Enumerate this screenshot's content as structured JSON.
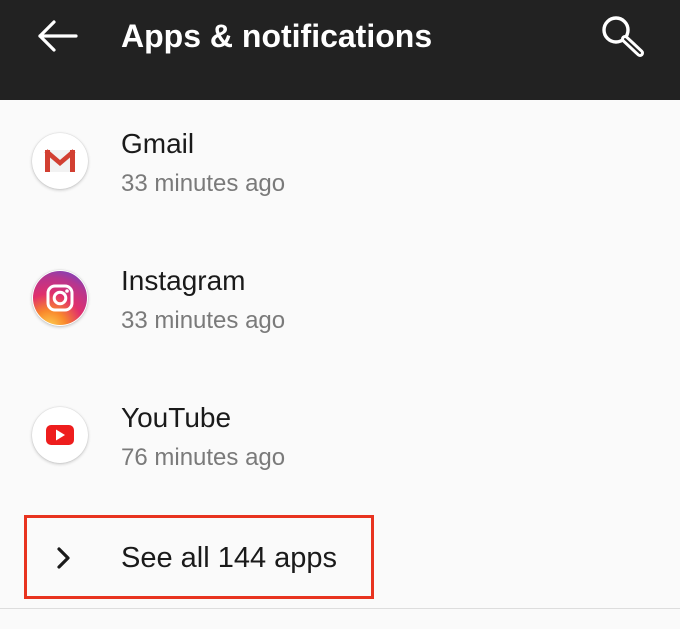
{
  "toolbar": {
    "title": "Apps & notifications",
    "back_icon": "arrow-left-icon",
    "search_icon": "search-icon",
    "background": "#222222"
  },
  "apps": [
    {
      "name": "Gmail",
      "time": "33 minutes ago",
      "icon": "gmail-icon"
    },
    {
      "name": "Instagram",
      "time": "33 minutes ago",
      "icon": "instagram-icon"
    },
    {
      "name": "YouTube",
      "time": "76 minutes ago",
      "icon": "youtube-icon"
    }
  ],
  "see_all": {
    "label": "See all 144 apps",
    "icon": "chevron-right-icon",
    "highlight_color": "#e8331f"
  }
}
